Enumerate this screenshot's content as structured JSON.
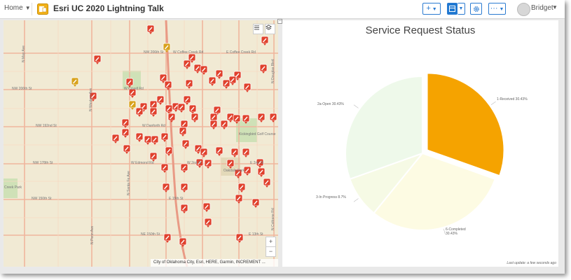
{
  "header": {
    "home_label": "Home",
    "app_title": "Esri UC 2020 Lightning Talk",
    "add_label": "+",
    "more_label": "···",
    "user_name": "Bridget"
  },
  "map": {
    "attribution": "City of Oklahoma City, Esri, HERE, Garmin, INCREMENT ...",
    "zoom_in": "+",
    "zoom_out": "−",
    "streets": [
      {
        "label": "NW 206th St"
      },
      {
        "label": "W Coffee Creek Rd"
      },
      {
        "label": "E Coffee Creek Rd"
      },
      {
        "label": "NW 206th St"
      },
      {
        "label": "W Covell Rd"
      },
      {
        "label": "W Danforth Rd"
      },
      {
        "label": "NW 192nd St"
      },
      {
        "label": "NW 178th St"
      },
      {
        "label": "W Edmond Rd"
      },
      {
        "label": "W 2nd St"
      },
      {
        "label": "E 2nd St"
      },
      {
        "label": "NW 150th St"
      },
      {
        "label": "NE 150th St"
      },
      {
        "label": "E 15th St"
      },
      {
        "label": "E 13th St"
      },
      {
        "label": "N May Ave"
      },
      {
        "label": "N Western Ave"
      },
      {
        "label": "N Douglas Blvd"
      },
      {
        "label": "N Coltrane Rd"
      },
      {
        "label": "N Santa Fe Ave"
      },
      {
        "label": "N Penn Ave"
      },
      {
        "label": "Kickingbird Golf Course"
      },
      {
        "label": "Oakdale Park"
      },
      {
        "label": "Creek Park"
      }
    ]
  },
  "chart_data": {
    "type": "pie",
    "title": "Service Request Status",
    "labels": [
      "1-Received 30.43%",
      "2a-Open 30.43%",
      "3-In Progress 8.7%",
      "6-Completed 30.43%"
    ],
    "slices": [
      {
        "name": "1-Received",
        "value": 30.43,
        "color": "#f5a300",
        "exploded": true
      },
      {
        "name": "6-Completed",
        "value": 30.43,
        "color": "#fdfbe3"
      },
      {
        "name": "3-In Progress",
        "value": 8.7,
        "color": "#f6fae5"
      },
      {
        "name": "2a-Open",
        "value": 30.43,
        "color": "#eef9ea"
      }
    ],
    "last_update": "Last update: a few seconds ago"
  },
  "colors": {
    "accent": "#1f78d1",
    "marker": "#e0412d",
    "marker_alt": "#d8a21c"
  }
}
